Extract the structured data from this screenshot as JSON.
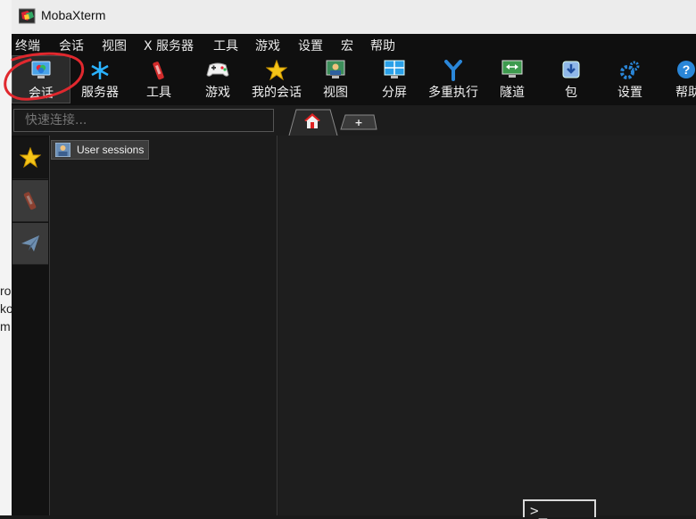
{
  "window": {
    "title": "MobaXterm"
  },
  "background_fragment": {
    "lines": [
      "ro",
      "ko",
      "m"
    ]
  },
  "menu": {
    "items": [
      "终端",
      "会话",
      "视图",
      "X 服务器",
      "工具",
      "游戏",
      "设置",
      "宏",
      "帮助"
    ]
  },
  "toolbar": {
    "items": [
      {
        "label": "会话",
        "icon": "session-icon",
        "active": true
      },
      {
        "label": "服务器",
        "icon": "servers-icon"
      },
      {
        "label": "工具",
        "icon": "tools-icon"
      },
      {
        "label": "游戏",
        "icon": "gamepad-icon"
      },
      {
        "label": "我的会话",
        "icon": "star-icon"
      },
      {
        "label": "视图",
        "icon": "view-icon"
      },
      {
        "label": "分屏",
        "icon": "split-icon"
      },
      {
        "label": "多重执行",
        "icon": "fork-icon"
      },
      {
        "label": "隧道",
        "icon": "tunnel-icon"
      },
      {
        "label": "包",
        "icon": "packages-icon"
      },
      {
        "label": "设置",
        "icon": "settings-icon"
      },
      {
        "label": "帮助",
        "icon": "help-icon"
      }
    ]
  },
  "quick_connect": {
    "placeholder": "快速连接..."
  },
  "sidebar": {
    "tree": {
      "root_label": "User sessions"
    },
    "side_icons": [
      "star-icon",
      "tools-icon",
      "paper-plane-icon"
    ]
  },
  "tabs": [
    {
      "icon": "home-icon",
      "active": true
    },
    {
      "icon": "plus-icon",
      "label": "+"
    }
  ],
  "terminal": {
    "prompt_glyph": ">_"
  },
  "colors": {
    "annotation": "#e0282e",
    "accent_blue": "#2a86d8",
    "star": "#f5c518"
  }
}
